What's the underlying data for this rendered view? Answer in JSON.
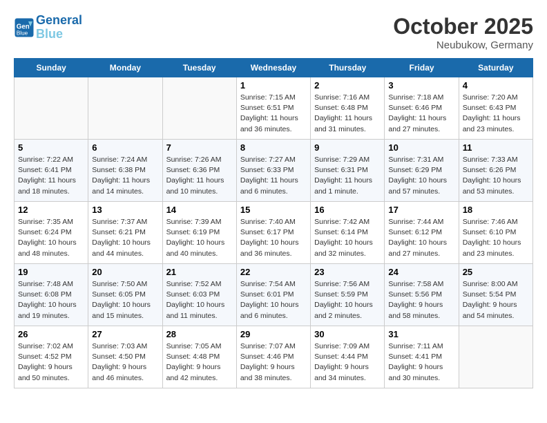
{
  "header": {
    "logo_line1": "General",
    "logo_line2": "Blue",
    "month": "October 2025",
    "location": "Neubukow, Germany"
  },
  "weekdays": [
    "Sunday",
    "Monday",
    "Tuesday",
    "Wednesday",
    "Thursday",
    "Friday",
    "Saturday"
  ],
  "weeks": [
    [
      {
        "day": "",
        "info": ""
      },
      {
        "day": "",
        "info": ""
      },
      {
        "day": "",
        "info": ""
      },
      {
        "day": "1",
        "info": "Sunrise: 7:15 AM\nSunset: 6:51 PM\nDaylight: 11 hours\nand 36 minutes."
      },
      {
        "day": "2",
        "info": "Sunrise: 7:16 AM\nSunset: 6:48 PM\nDaylight: 11 hours\nand 31 minutes."
      },
      {
        "day": "3",
        "info": "Sunrise: 7:18 AM\nSunset: 6:46 PM\nDaylight: 11 hours\nand 27 minutes."
      },
      {
        "day": "4",
        "info": "Sunrise: 7:20 AM\nSunset: 6:43 PM\nDaylight: 11 hours\nand 23 minutes."
      }
    ],
    [
      {
        "day": "5",
        "info": "Sunrise: 7:22 AM\nSunset: 6:41 PM\nDaylight: 11 hours\nand 18 minutes."
      },
      {
        "day": "6",
        "info": "Sunrise: 7:24 AM\nSunset: 6:38 PM\nDaylight: 11 hours\nand 14 minutes."
      },
      {
        "day": "7",
        "info": "Sunrise: 7:26 AM\nSunset: 6:36 PM\nDaylight: 11 hours\nand 10 minutes."
      },
      {
        "day": "8",
        "info": "Sunrise: 7:27 AM\nSunset: 6:33 PM\nDaylight: 11 hours\nand 6 minutes."
      },
      {
        "day": "9",
        "info": "Sunrise: 7:29 AM\nSunset: 6:31 PM\nDaylight: 11 hours\nand 1 minute."
      },
      {
        "day": "10",
        "info": "Sunrise: 7:31 AM\nSunset: 6:29 PM\nDaylight: 10 hours\nand 57 minutes."
      },
      {
        "day": "11",
        "info": "Sunrise: 7:33 AM\nSunset: 6:26 PM\nDaylight: 10 hours\nand 53 minutes."
      }
    ],
    [
      {
        "day": "12",
        "info": "Sunrise: 7:35 AM\nSunset: 6:24 PM\nDaylight: 10 hours\nand 48 minutes."
      },
      {
        "day": "13",
        "info": "Sunrise: 7:37 AM\nSunset: 6:21 PM\nDaylight: 10 hours\nand 44 minutes."
      },
      {
        "day": "14",
        "info": "Sunrise: 7:39 AM\nSunset: 6:19 PM\nDaylight: 10 hours\nand 40 minutes."
      },
      {
        "day": "15",
        "info": "Sunrise: 7:40 AM\nSunset: 6:17 PM\nDaylight: 10 hours\nand 36 minutes."
      },
      {
        "day": "16",
        "info": "Sunrise: 7:42 AM\nSunset: 6:14 PM\nDaylight: 10 hours\nand 32 minutes."
      },
      {
        "day": "17",
        "info": "Sunrise: 7:44 AM\nSunset: 6:12 PM\nDaylight: 10 hours\nand 27 minutes."
      },
      {
        "day": "18",
        "info": "Sunrise: 7:46 AM\nSunset: 6:10 PM\nDaylight: 10 hours\nand 23 minutes."
      }
    ],
    [
      {
        "day": "19",
        "info": "Sunrise: 7:48 AM\nSunset: 6:08 PM\nDaylight: 10 hours\nand 19 minutes."
      },
      {
        "day": "20",
        "info": "Sunrise: 7:50 AM\nSunset: 6:05 PM\nDaylight: 10 hours\nand 15 minutes."
      },
      {
        "day": "21",
        "info": "Sunrise: 7:52 AM\nSunset: 6:03 PM\nDaylight: 10 hours\nand 11 minutes."
      },
      {
        "day": "22",
        "info": "Sunrise: 7:54 AM\nSunset: 6:01 PM\nDaylight: 10 hours\nand 6 minutes."
      },
      {
        "day": "23",
        "info": "Sunrise: 7:56 AM\nSunset: 5:59 PM\nDaylight: 10 hours\nand 2 minutes."
      },
      {
        "day": "24",
        "info": "Sunrise: 7:58 AM\nSunset: 5:56 PM\nDaylight: 9 hours\nand 58 minutes."
      },
      {
        "day": "25",
        "info": "Sunrise: 8:00 AM\nSunset: 5:54 PM\nDaylight: 9 hours\nand 54 minutes."
      }
    ],
    [
      {
        "day": "26",
        "info": "Sunrise: 7:02 AM\nSunset: 4:52 PM\nDaylight: 9 hours\nand 50 minutes."
      },
      {
        "day": "27",
        "info": "Sunrise: 7:03 AM\nSunset: 4:50 PM\nDaylight: 9 hours\nand 46 minutes."
      },
      {
        "day": "28",
        "info": "Sunrise: 7:05 AM\nSunset: 4:48 PM\nDaylight: 9 hours\nand 42 minutes."
      },
      {
        "day": "29",
        "info": "Sunrise: 7:07 AM\nSunset: 4:46 PM\nDaylight: 9 hours\nand 38 minutes."
      },
      {
        "day": "30",
        "info": "Sunrise: 7:09 AM\nSunset: 4:44 PM\nDaylight: 9 hours\nand 34 minutes."
      },
      {
        "day": "31",
        "info": "Sunrise: 7:11 AM\nSunset: 4:41 PM\nDaylight: 9 hours\nand 30 minutes."
      },
      {
        "day": "",
        "info": ""
      }
    ]
  ]
}
